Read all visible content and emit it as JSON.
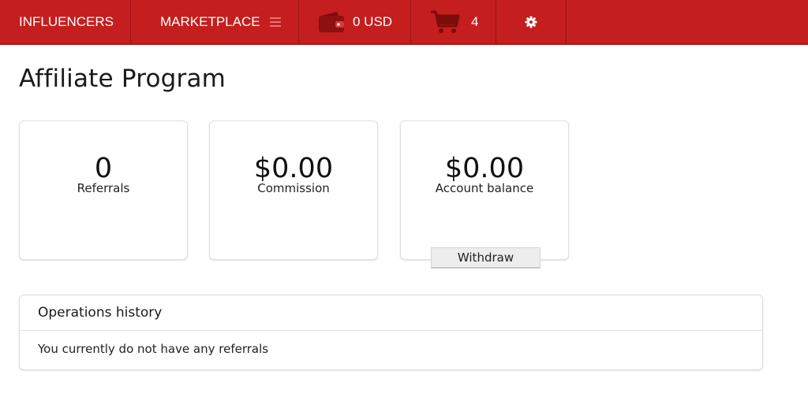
{
  "topbar": {
    "influencers_label": "INFLUENCERS",
    "marketplace_label": "MARKETPLACE",
    "wallet_amount": "0 USD",
    "cart_count": "4",
    "accent_color": "#c41e1e",
    "icons": {
      "menu": "hamburger-icon",
      "wallet": "wallet-icon",
      "cart": "cart-icon",
      "settings": "gear-icon"
    }
  },
  "page": {
    "title": "Affiliate Program"
  },
  "stats": {
    "referrals": {
      "value": "0",
      "label": "Referrals"
    },
    "commission": {
      "value": "$0.00",
      "label": "Commission"
    },
    "balance": {
      "value": "$0.00",
      "label": "Account balance"
    },
    "withdraw_label": "Withdraw"
  },
  "history": {
    "title": "Operations history",
    "empty_message": "You currently do not have any referrals"
  }
}
